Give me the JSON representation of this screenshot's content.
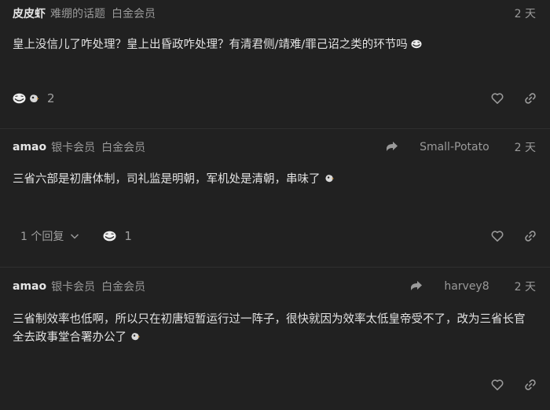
{
  "posts": [
    {
      "username": "皮皮虾",
      "badges": [
        "难绷的话题",
        "白金会员"
      ],
      "date": "2 天",
      "body": "皇上没信儿了咋处理？皇上出昏政咋处理？有清君侧/靖难/罪己诏之类的环节吗",
      "reaction_count": "2"
    },
    {
      "username": "amao",
      "badges": [
        "银卡会员",
        "白金会员"
      ],
      "reply_to": "Small-Potato",
      "date": "2 天",
      "body": "三省六部是初唐体制，司礼监是明朝，军机处是清朝，串味了",
      "replies_label": "1 个回复",
      "reaction_count": "1"
    },
    {
      "username": "amao",
      "badges": [
        "银卡会员",
        "白金会员"
      ],
      "reply_to": "harvey8",
      "date": "2 天",
      "body": "三省制效率也低啊，所以只在初唐短暂运行过一阵子，很快就因为效率太低皇帝受不了，改为三省长官全去政事堂合署办公了"
    }
  ],
  "icons": {
    "like": "heart-icon",
    "link": "link-icon",
    "reply_to": "reply-arrow-icon",
    "expand": "chevron-down-icon",
    "reaction_a": "troll-face-emoji",
    "reaction_b": "bird-face-emoji"
  },
  "colors": {
    "background": "#212121",
    "text": "#e2e2e2",
    "muted": "#9a9a9a",
    "divider": "#2f2f2f"
  }
}
